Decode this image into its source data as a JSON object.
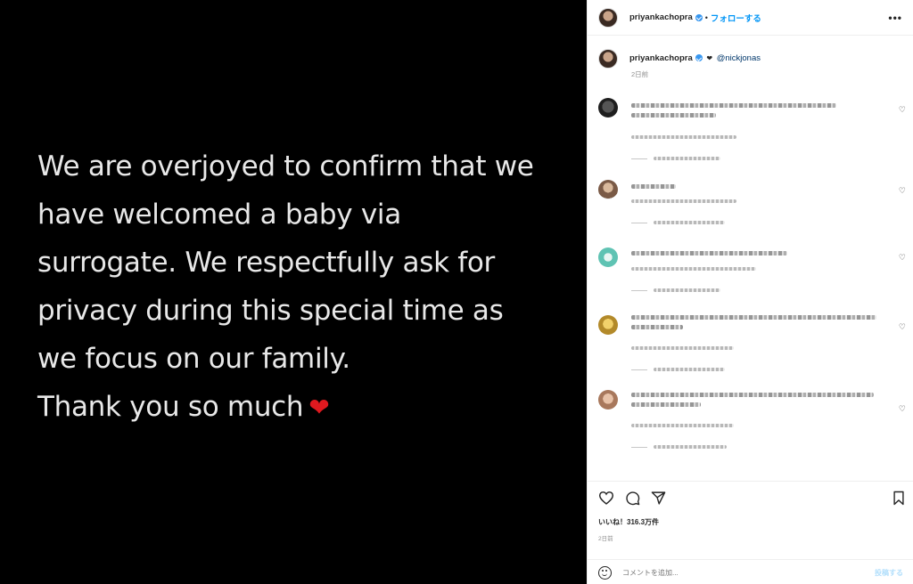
{
  "post": {
    "lines": [
      "We are overjoyed to confirm that we",
      "have welcomed a baby via",
      "surrogate. We respectfully ask for",
      "privacy during this special time as",
      "we focus on our family.",
      "Thank you so much"
    ],
    "emoji": "❤"
  },
  "header": {
    "username": "priyankachopra",
    "separator": "•",
    "follow_label": "フォローする",
    "more_label": "•••"
  },
  "caption": {
    "username": "priyankachopra",
    "heart": "❤",
    "mention": "@nickjonas",
    "timestamp": "2日前"
  },
  "actions": {
    "likes_text": "いいね！316.3万件",
    "date_text": "2日前",
    "comment_placeholder": "コメントを追加...",
    "post_label": "投稿する"
  },
  "colors": {
    "accent": "#0095f6",
    "verified": "#3897f0",
    "heart": "#e0191f"
  }
}
